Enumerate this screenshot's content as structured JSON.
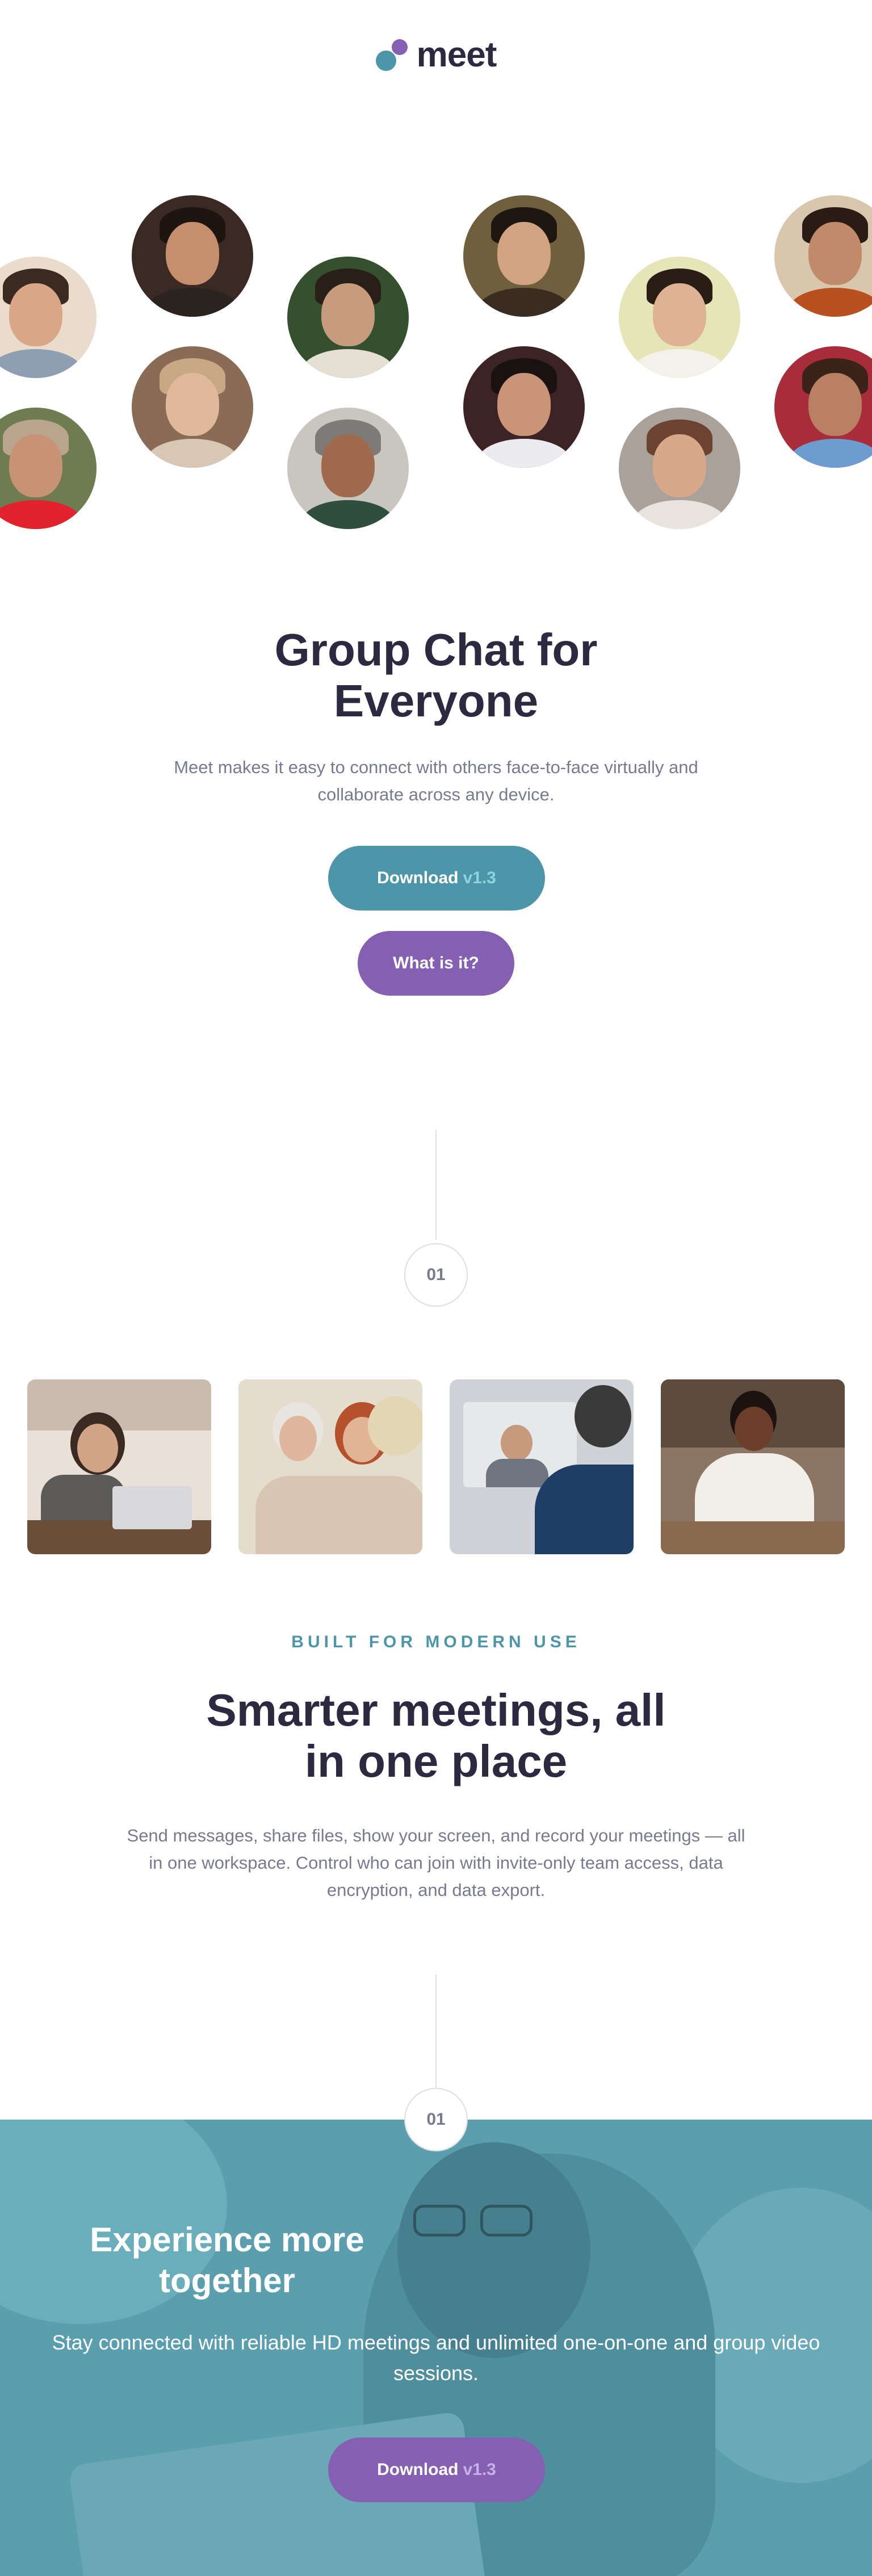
{
  "header": {
    "logo_text": "meet",
    "logo_colors": {
      "teal": "#4d96a9",
      "purple": "#855fb1"
    }
  },
  "avatars": [
    {
      "name": "avatar-1"
    },
    {
      "name": "avatar-2"
    },
    {
      "name": "avatar-3"
    },
    {
      "name": "avatar-4"
    },
    {
      "name": "avatar-5"
    },
    {
      "name": "avatar-6"
    },
    {
      "name": "avatar-7"
    },
    {
      "name": "avatar-8"
    },
    {
      "name": "avatar-9"
    },
    {
      "name": "avatar-10"
    },
    {
      "name": "avatar-11"
    },
    {
      "name": "avatar-12"
    },
    {
      "name": "avatar-13"
    },
    {
      "name": "avatar-14"
    }
  ],
  "hero": {
    "title_line1": "Group Chat for",
    "title_line2": "Everyone",
    "subtitle": "Meet makes it easy to connect with others face-to-face virtually and collaborate across any device.",
    "download_label": "Download",
    "download_version": "v1.3",
    "what_label": "What is it?"
  },
  "steps": {
    "first": "01",
    "second": "01"
  },
  "features": {
    "eyebrow": "BUILT FOR MODERN USE",
    "title_line1": "Smarter meetings, all",
    "title_line2": "in one place",
    "body": "Send messages, share files, show your screen, and record your meetings — all in one workspace. Control who can join with invite-only team access, data encryption, and data export."
  },
  "cta": {
    "title_line1": "Experience more",
    "title_line2": "together",
    "body": "Stay connected with reliable HD meetings and unlimited one-on-one and group video sessions.",
    "download_label": "Download",
    "download_version": "v1.3"
  },
  "colors": {
    "primary_text": "#2c2a40",
    "muted_text": "#787a91",
    "teal": "#4d96a9",
    "purple": "#855fb1"
  }
}
